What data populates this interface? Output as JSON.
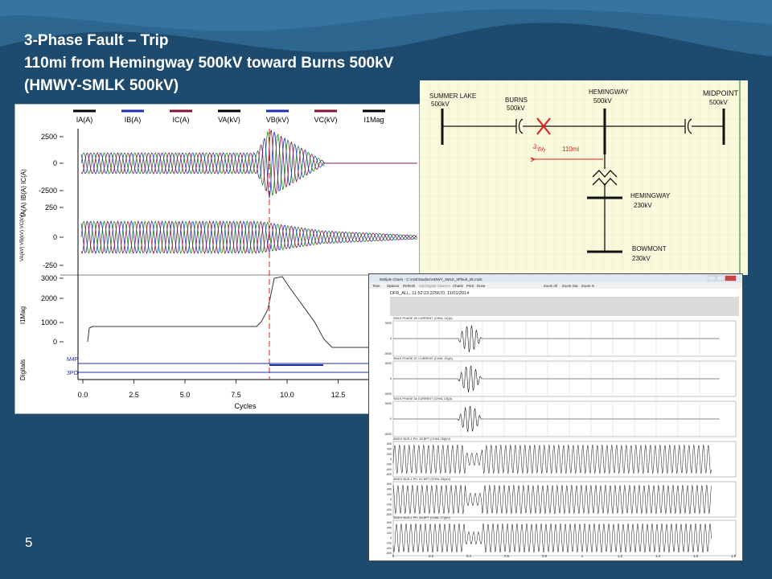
{
  "slide": {
    "title_line1": "3-Phase Fault – Trip",
    "title_line2": "110mi from Hemingway 500kV toward Burns 500kV",
    "title_line3": "(HMWY-SMLK 500kV)",
    "page_number": "5",
    "colors": {
      "background": "#1e4a6e",
      "wave": "#2f6a94"
    }
  },
  "left_chart": {
    "legend": [
      "IA(A)",
      "IB(A)",
      "IC(A)",
      "VA(kV)",
      "VB(kV)",
      "VC(kV)",
      "I1Mag"
    ],
    "legend_colors": [
      "#000000",
      "#1f2fb0",
      "#8a1040",
      "#000000",
      "#1f2fb0",
      "#8a1040",
      "#000000"
    ],
    "current_axis_label": "IA(A) IB(A) IC(A)",
    "current_ticks": [
      "2500",
      "0",
      "-2500"
    ],
    "voltage_axis_label": "VA(kV) VB(kV) VC(kV)",
    "voltage_ticks": [
      "250",
      "0",
      "-250"
    ],
    "mag_axis_label": "I1Mag",
    "mag_ticks": [
      "3000",
      "2000",
      "1000",
      "0"
    ],
    "digitals_label": "Digitals",
    "digital_channels": [
      "M4P",
      "3PO"
    ],
    "x_ticks": [
      "0.0",
      "2.5",
      "5.0",
      "7.5",
      "10.0",
      "12.5"
    ],
    "x_label": "Cycles"
  },
  "sketch": {
    "bus_summer_lake": "SUMMER LAKE",
    "bus_summer_lake_kv": "500kV",
    "bus_burns": "BURNS",
    "bus_burns_kv": "500kV",
    "bus_hemingway": "HEMINGWAY",
    "bus_hemingway_kv": "500kV",
    "bus_midpoint": "MIDPOINT",
    "bus_midpoint_kv": "500kV",
    "fault_label": "3-ph",
    "distance_label": "110mi",
    "bus_hemingway230": "HEMINGWAY",
    "bus_hemingway230_kv": "230kV",
    "bus_bowmont": "BOWMONT",
    "bus_bowmont_kv": "230kV"
  },
  "window": {
    "title": "Multiple Charts - C:\\ASE\\Studies\\HMWY_SMLK_3Pfault_all.cmds",
    "menu": [
      "Time",
      "Options",
      "Refresh",
      "Add Digital Channel",
      "Charts",
      "Print",
      "Done",
      "Zoom All",
      "Zoom Out",
      "Zoom In"
    ],
    "header": "DFR_ALL, 11:52:23.225670, 11/01/2014",
    "charts": [
      {
        "label": "SMLK PHASE 1B CURRENT (CHNL 14)(A)",
        "ticks": [
          "5000",
          "0",
          "-5000"
        ]
      },
      {
        "label": "SMLK PHASE 2C CURRENT (CHNL 15)(A)",
        "ticks": [
          "5000",
          "0",
          "-5000"
        ]
      },
      {
        "label": "SMLK PHASE 3A CURRENT (CHNL 13)(A)",
        "ticks": [
          "5000",
          "0",
          "-5000"
        ]
      },
      {
        "label": "500KV BUS-1 PH. 1B BPT (CHNL 25)(kV)",
        "ticks": [
          "600",
          "400",
          "200",
          "0",
          "-200",
          "-400",
          "-600"
        ]
      },
      {
        "label": "500KV BUS-1 PH. 2C BPT (CHNL 26)(kV)",
        "ticks": [
          "600",
          "400",
          "200",
          "0",
          "-200",
          "-400",
          "-600"
        ]
      },
      {
        "label": "500KV BUS-1 PH. 3A BPT (CHNL 27)(kV)",
        "ticks": [
          "600",
          "400",
          "200",
          "0",
          "-200",
          "-400",
          "-600"
        ]
      }
    ],
    "x_ticks": [
      "0",
      "0.2",
      "0.4",
      "0.6",
      "0.8",
      "1",
      "1.2",
      "1.4",
      "1.6",
      "1.8"
    ]
  }
}
